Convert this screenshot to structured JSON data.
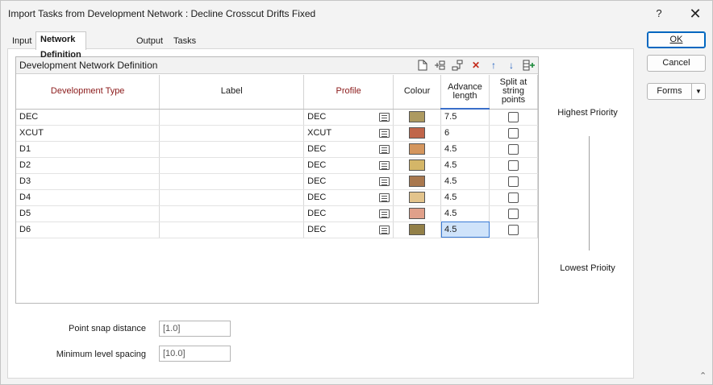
{
  "window": {
    "title": "Import Tasks from Development Network : Decline Crosscut Drifts Fixed",
    "help_label": "?",
    "close_label": "✕"
  },
  "tabs": [
    {
      "label": "Input"
    },
    {
      "label": "Network Definition"
    },
    {
      "label": "Output"
    },
    {
      "label": "Tasks"
    }
  ],
  "grid": {
    "title": "Development Network Definition",
    "toolbar_icons": [
      "new-file-icon",
      "insert-row-icon",
      "append-row-icon",
      "delete-icon",
      "move-up-icon",
      "move-down-icon",
      "add-columns-icon"
    ],
    "columns": [
      "Development Type",
      "Label",
      "Profile",
      "Colour",
      "Advance length",
      "Split at string points"
    ],
    "rows": [
      {
        "type": "DEC",
        "label": "",
        "profile": "DEC",
        "colour": "#ad9a60",
        "advance": "7.5",
        "split": false
      },
      {
        "type": "XCUT",
        "label": "",
        "profile": "XCUT",
        "colour": "#c0654a",
        "advance": "6",
        "split": false
      },
      {
        "type": "D1",
        "label": "",
        "profile": "DEC",
        "colour": "#d4965e",
        "advance": "4.5",
        "split": false
      },
      {
        "type": "D2",
        "label": "",
        "profile": "DEC",
        "colour": "#d4b668",
        "advance": "4.5",
        "split": false
      },
      {
        "type": "D3",
        "label": "",
        "profile": "DEC",
        "colour": "#a9784e",
        "advance": "4.5",
        "split": false
      },
      {
        "type": "D4",
        "label": "",
        "profile": "DEC",
        "colour": "#e3c48c",
        "advance": "4.5",
        "split": false
      },
      {
        "type": "D5",
        "label": "",
        "profile": "DEC",
        "colour": "#e0a08a",
        "advance": "4.5",
        "split": false
      },
      {
        "type": "D6",
        "label": "",
        "profile": "DEC",
        "colour": "#938048",
        "advance": "4.5",
        "split": false
      }
    ],
    "selected_row": 7
  },
  "priority": {
    "highest": "Highest Priority",
    "lowest": "Lowest Prioity"
  },
  "fields": {
    "point_snap_label": "Point snap distance",
    "point_snap_value": "[1.0]",
    "min_level_label": "Minimum level spacing",
    "min_level_value": "[10.0]"
  },
  "buttons": {
    "ok": "OK",
    "cancel": "Cancel",
    "forms": "Forms"
  },
  "colors": {
    "required_header": "#8b1a1a",
    "accent": "#0067c0"
  }
}
